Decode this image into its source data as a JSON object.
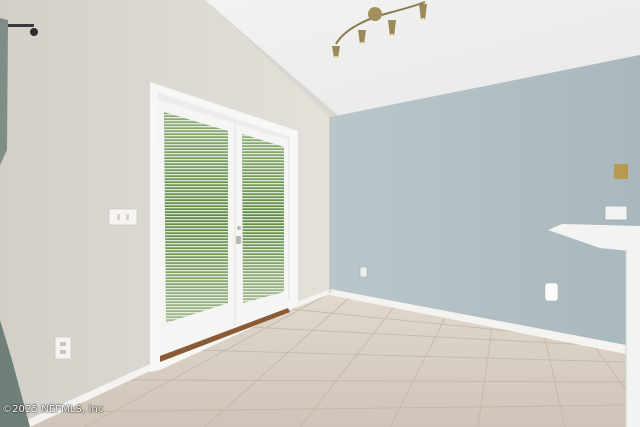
{
  "photo": {
    "subject": "Empty room with tile floor and French doors",
    "watermark": "©2025 NEFMLS, Inc",
    "colors": {
      "ceiling": "#efefee",
      "left_wall": "#dedbd5",
      "right_wall": "#b2c0c4",
      "floor": "#d8cfc3",
      "baseboard": "#f4f3f0",
      "door_frame": "#f7f7f6",
      "foliage": "#5f8a45"
    }
  }
}
